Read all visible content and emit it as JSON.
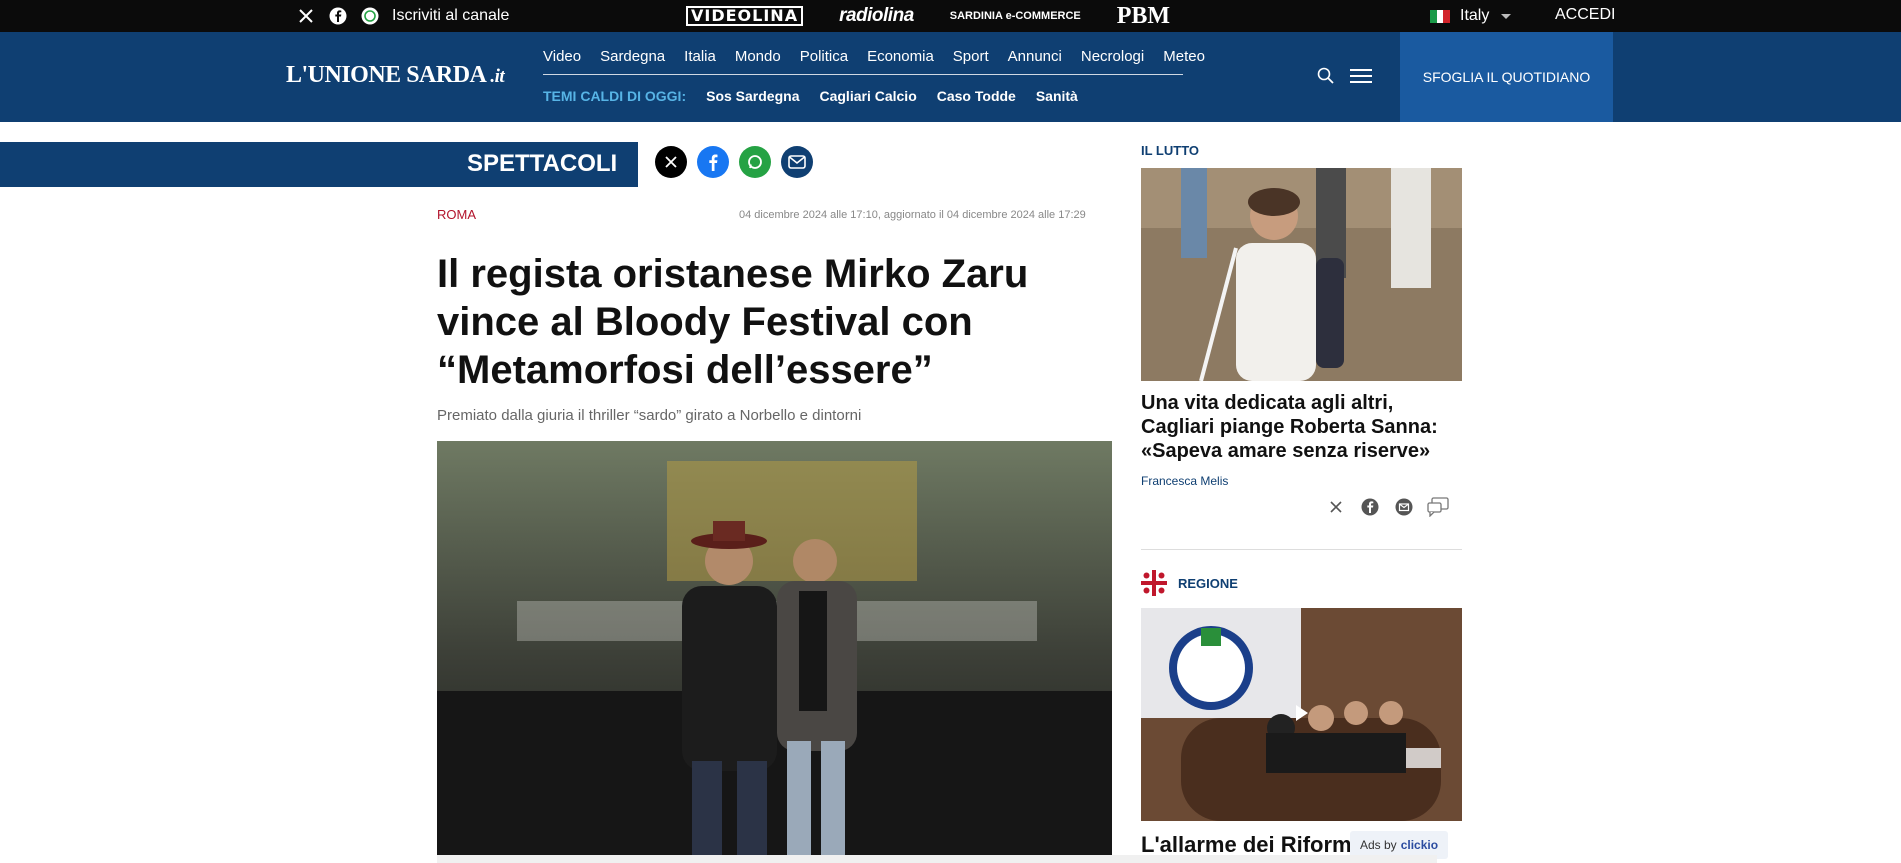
{
  "topbar": {
    "subscribe_text": "Iscriviti al canale",
    "brands": [
      "VIDEOLINA",
      "radiolina",
      "SARDINIA e-COMMERCE",
      "PBM"
    ],
    "country": "Italy",
    "login": "ACCEDI"
  },
  "header": {
    "logo_main": "L'UNIONE SARDA",
    "logo_suffix": ".it",
    "nav": [
      "Video",
      "Sardegna",
      "Italia",
      "Mondo",
      "Politica",
      "Economia",
      "Sport",
      "Annunci",
      "Necrologi",
      "Meteo"
    ],
    "hot_label": "TEMI CALDI DI OGGI:",
    "hot_topics": [
      "Sos Sardegna",
      "Cagliari Calcio",
      "Caso Todde",
      "Sanità"
    ],
    "cta": "SFOGLIA IL QUOTIDIANO"
  },
  "article": {
    "section": "SPETTACOLI",
    "kicker": "ROMA",
    "dates": "04 dicembre 2024 alle 17:10, aggiornato il 04 dicembre 2024 alle 17:29",
    "title": "Il regista oristanese Mirko Zaru vince al Bloody Festival con “Metamorfosi dell’essere”",
    "subtitle": "Premiato dalla giuria il thriller “sardo” girato a Norbello e dintorni"
  },
  "sidebar": {
    "card1": {
      "kicker": "IL LUTTO",
      "title": "Una vita dedicata agli altri, Cagliari piange Roberta Sanna: «Sapeva amare senza riserve»",
      "author": "Francesca Melis"
    },
    "card2": {
      "kicker": "REGIONE",
      "title_partial": "L'allarme dei Riform"
    },
    "ads_label": "Ads by",
    "ads_brand": "clickio"
  },
  "colors": {
    "brand_navy": "#0f3f72",
    "cta_blue": "#1a5aa0",
    "kicker_red": "#b2132b",
    "topbar": "#0b0b0b"
  }
}
